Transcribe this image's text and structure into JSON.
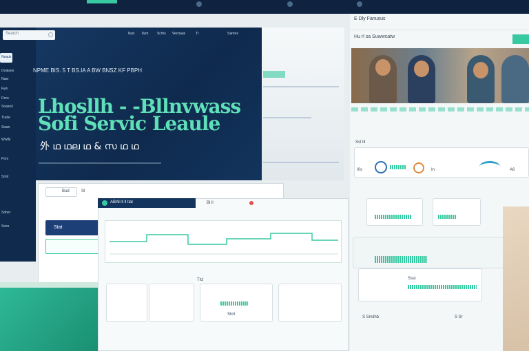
{
  "search": {
    "placeholder": "Search"
  },
  "top_nav": [
    "Ilust",
    "Ilum",
    "Sr.fos",
    "Vecnaus",
    "Tr",
    "Sanres"
  ],
  "sidebar": {
    "items": [
      "Neauk",
      "Doalaes",
      "Naer",
      "Fyw",
      "Dreo",
      "Soasrvl",
      "Trade",
      "Ssaw",
      "Wwlfy",
      "Pom",
      "Smtr",
      "Sdoer",
      "Soes"
    ]
  },
  "hero": {
    "tagline": "NPME BIS. 5 T BS.IA A BW BNSZ KF PBPH",
    "title_line1": "Lhosllh - -Bllnvwass",
    "title_line2": "Sofi Servic Leaule",
    "subtitle": "外 ഥ ഥല ഥ & സ ഥ ഥ"
  },
  "right": {
    "header": "E Dly   Fanusus",
    "tabs": "Hu rl sa Suwwcatw",
    "stat1": "I0s",
    "stat2": "In",
    "stat3": "A6",
    "section_label": "Ssl tll",
    "card_label": "Ssst",
    "footer_a": "S  Smilhb",
    "footer_b": "S Sr"
  },
  "bottom_left": {
    "btn_label": "Stat",
    "tab_a": "Bud",
    "tab_b": "Sl"
  },
  "center": {
    "title": "ABAll ll ll  tlal",
    "tab": "Bl ll",
    "card_head": "Tlcl",
    "stat": "Slcil"
  },
  "colors": {
    "accent": "#39c9a2",
    "navy": "#12345d",
    "hero_text": "#5fe0b8"
  }
}
